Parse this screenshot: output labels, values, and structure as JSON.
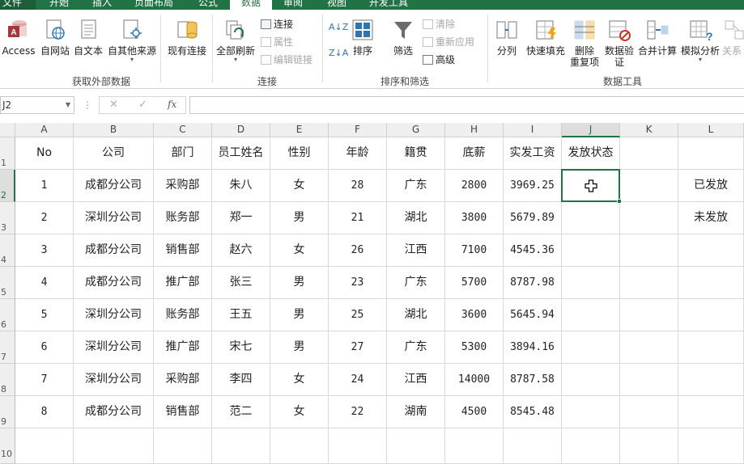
{
  "ribbon_tabs": [
    "文件",
    "开始",
    "插入",
    "页面布局",
    "公式",
    "数据",
    "审阅",
    "视图",
    "开发工具"
  ],
  "ribbon": {
    "external": {
      "access": "Access",
      "web": "自网站",
      "text": "自文本",
      "other": "自其他来源",
      "existing": "现有连接",
      "label": "获取外部数据"
    },
    "connections": {
      "refresh": "全部刷新",
      "connect": "连接",
      "properties": "属性",
      "edit_links": "编辑链接",
      "label": "连接"
    },
    "sort": {
      "sort_az": "A↓Z",
      "sort_za": "Z↓A",
      "sort": "排序",
      "filter": "筛选",
      "clear": "清除",
      "reapply": "重新应用",
      "advanced": "高级",
      "label": "排序和筛选"
    },
    "tools": {
      "split": "分列",
      "flash": "快速填充",
      "dedupe1": "删除",
      "dedupe2": "重复项",
      "validation1": "数据验",
      "validation2": "证",
      "consolidate": "合并计算",
      "whatif": "模拟分析",
      "relations": "关系",
      "label": "数据工具"
    }
  },
  "formula_bar": {
    "name_box": "J2",
    "cancel": "✕",
    "enter": "✓",
    "fx": "fx",
    "value": ""
  },
  "columns": [
    "A",
    "B",
    "C",
    "D",
    "E",
    "F",
    "G",
    "H",
    "I",
    "J",
    "K",
    "L"
  ],
  "rows": [
    "1",
    "2",
    "3",
    "4",
    "5",
    "6",
    "7",
    "8",
    "9",
    "10"
  ],
  "headers": [
    "No",
    "公司",
    "部门",
    "员工姓名",
    "性别",
    "年龄",
    "籍贯",
    "底薪",
    "实发工资",
    "发放状态"
  ],
  "data": [
    [
      "1",
      "成都分公司",
      "采购部",
      "朱八",
      "女",
      "28",
      "广东",
      "2800",
      "3969.25"
    ],
    [
      "2",
      "深圳分公司",
      "账务部",
      "郑一",
      "男",
      "21",
      "湖北",
      "3800",
      "5679.89"
    ],
    [
      "3",
      "成都分公司",
      "销售部",
      "赵六",
      "女",
      "26",
      "江西",
      "7100",
      "4545.36"
    ],
    [
      "4",
      "成都分公司",
      "推广部",
      "张三",
      "男",
      "23",
      "广东",
      "5700",
      "8787.98"
    ],
    [
      "5",
      "深圳分公司",
      "账务部",
      "王五",
      "男",
      "25",
      "湖北",
      "3600",
      "5645.94"
    ],
    [
      "6",
      "深圳分公司",
      "推广部",
      "宋七",
      "男",
      "27",
      "广东",
      "5300",
      "3894.16"
    ],
    [
      "7",
      "深圳分公司",
      "采购部",
      "李四",
      "女",
      "24",
      "江西",
      "14000",
      "8787.58"
    ],
    [
      "8",
      "成都分公司",
      "销售部",
      "范二",
      "女",
      "22",
      "湖南",
      "4500",
      "8545.48"
    ]
  ],
  "status_options": [
    "已发放",
    "未发放"
  ],
  "colors": {
    "accent": "#217346"
  }
}
